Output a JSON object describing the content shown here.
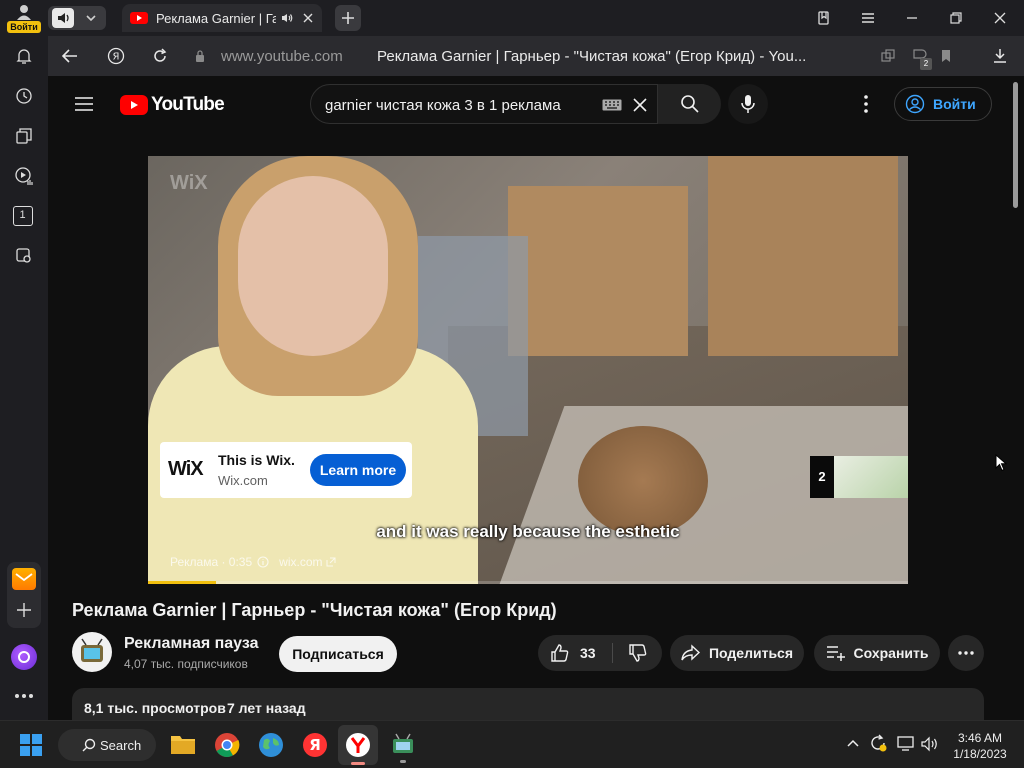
{
  "browser": {
    "profile_label": "Войти",
    "tab_title": "Реклама Garnier | Гар",
    "address": "www.youtube.com",
    "page_title": "Реклама Garnier | Гарньер - \"Чистая кожа\" (Егор Крид) - You...",
    "badge_count": "2"
  },
  "sidebar": {
    "badge": "1"
  },
  "youtube": {
    "logo_text": "YouTube",
    "search_value": "garnier чистая кожа 3 в 1 реклама",
    "signin_label": "Войти",
    "video": {
      "watermark": "WiX",
      "ad_brand_logo": "WiX",
      "ad_title": "This is Wix.",
      "ad_domain": "Wix.com",
      "ad_cta": "Learn more",
      "subtitle": "and it was really because the esthetic",
      "ad_label": "Реклама · 0:35",
      "ad_site": "wix.com",
      "ad_progress": 0.09,
      "next_ad_count": "2"
    },
    "title": "Реклама Garnier | Гарньер - \"Чистая кожа\" (Егор Крид)",
    "channel_name": "Рекламная пауза",
    "subscribers": "4,07 тыс. подписчиков",
    "subscribe_label": "Подписаться",
    "like_count": "33",
    "share_label": "Поделиться",
    "save_label": "Сохранить",
    "views": "8,1 тыс. просмотров",
    "age": "7 лет назад"
  },
  "taskbar": {
    "search_label": "Search",
    "time": "3:46 AM",
    "date": "1/18/2023"
  }
}
